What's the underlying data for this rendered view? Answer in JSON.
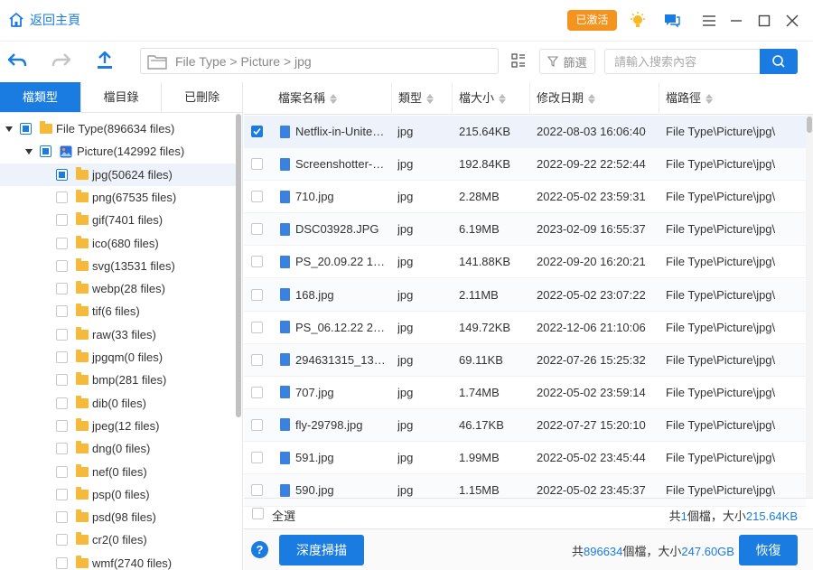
{
  "title_bar": {
    "home_label": "返回主頁",
    "activated_label": "已激活",
    "icons": [
      "home-icon",
      "lightbulb-icon",
      "feedback-icon",
      "menu-icon",
      "minimize-icon",
      "maximize-icon",
      "close-icon"
    ]
  },
  "toolbar": {
    "path": "File Type > Picture > jpg",
    "filter_label": "篩選",
    "search_placeholder": "請輸入搜索內容",
    "icons": [
      "back-icon",
      "forward-icon",
      "export-icon",
      "folder-icon",
      "view-toggle-icon",
      "filter-icon",
      "search-icon"
    ]
  },
  "left_panel": {
    "tabs": [
      "檔類型",
      "檔目錄",
      "已刪除"
    ],
    "active_tab": 0,
    "tree": [
      {
        "label": "File Type(896634 files)",
        "level": 0,
        "expanded": true,
        "check": "partial"
      },
      {
        "label": "Picture(142992 files)",
        "level": 1,
        "expanded": true,
        "check": "partial",
        "icon": "picture-icon"
      },
      {
        "label": "jpg(50624 files)",
        "level": 2,
        "check": "partial",
        "selected": true
      },
      {
        "label": "png(67535 files)",
        "level": 2,
        "check": "none"
      },
      {
        "label": "gif(7401 files)",
        "level": 2,
        "check": "none"
      },
      {
        "label": "ico(680 files)",
        "level": 2,
        "check": "none"
      },
      {
        "label": "svg(13531 files)",
        "level": 2,
        "check": "none"
      },
      {
        "label": "webp(28 files)",
        "level": 2,
        "check": "none"
      },
      {
        "label": "tif(6 files)",
        "level": 2,
        "check": "none"
      },
      {
        "label": "raw(33 files)",
        "level": 2,
        "check": "none"
      },
      {
        "label": "jpgqm(0 files)",
        "level": 2,
        "check": "none"
      },
      {
        "label": "bmp(281 files)",
        "level": 2,
        "check": "none"
      },
      {
        "label": "dib(0 files)",
        "level": 2,
        "check": "none"
      },
      {
        "label": "jpeg(12 files)",
        "level": 2,
        "check": "none"
      },
      {
        "label": "dng(0 files)",
        "level": 2,
        "check": "none"
      },
      {
        "label": "nef(0 files)",
        "level": 2,
        "check": "none"
      },
      {
        "label": "psp(0 files)",
        "level": 2,
        "check": "none"
      },
      {
        "label": "psd(98 files)",
        "level": 2,
        "check": "none"
      },
      {
        "label": "cr2(0 files)",
        "level": 2,
        "check": "none"
      },
      {
        "label": "wmf(2740 files)",
        "level": 2,
        "check": "none"
      }
    ]
  },
  "table": {
    "columns": [
      "檔案名稱",
      "類型",
      "檔大小",
      "修改日期",
      "檔路徑"
    ],
    "rows": [
      {
        "name": "Netflix-in-Unite…",
        "type": "jpg",
        "size": "215.64KB",
        "date": "2022-08-03 16:06:40",
        "path": "File Type\\Picture\\jpg\\",
        "checked": true
      },
      {
        "name": "Screenshotter-…",
        "type": "jpg",
        "size": "192.84KB",
        "date": "2022-09-22 22:52:44",
        "path": "File Type\\Picture\\jpg\\",
        "checked": false
      },
      {
        "name": "710.jpg",
        "type": "jpg",
        "size": "2.28MB",
        "date": "2022-05-02 23:59:31",
        "path": "File Type\\Picture\\jpg\\",
        "checked": false
      },
      {
        "name": "DSC03928.JPG",
        "type": "jpg",
        "size": "6.19MB",
        "date": "2023-02-09 16:55:37",
        "path": "File Type\\Picture\\jpg\\",
        "checked": false
      },
      {
        "name": "PS_20.09.22 1…",
        "type": "jpg",
        "size": "141.88KB",
        "date": "2022-09-20 16:20:21",
        "path": "File Type\\Picture\\jpg\\",
        "checked": false
      },
      {
        "name": "168.jpg",
        "type": "jpg",
        "size": "2.11MB",
        "date": "2022-05-02 23:07:22",
        "path": "File Type\\Picture\\jpg\\",
        "checked": false
      },
      {
        "name": "PS_06.12.22 2…",
        "type": "jpg",
        "size": "149.72KB",
        "date": "2022-12-06 21:10:06",
        "path": "File Type\\Picture\\jpg\\",
        "checked": false
      },
      {
        "name": "294631315_13…",
        "type": "jpg",
        "size": "69.11KB",
        "date": "2022-07-26 15:25:32",
        "path": "File Type\\Picture\\jpg\\",
        "checked": false
      },
      {
        "name": "707.jpg",
        "type": "jpg",
        "size": "1.74MB",
        "date": "2022-05-02 23:59:14",
        "path": "File Type\\Picture\\jpg\\",
        "checked": false
      },
      {
        "name": "fly-29798.jpg",
        "type": "jpg",
        "size": "46.17KB",
        "date": "2022-07-27 15:20:10",
        "path": "File Type\\Picture\\jpg\\",
        "checked": false
      },
      {
        "name": "591.jpg",
        "type": "jpg",
        "size": "1.99MB",
        "date": "2022-05-02 23:45:44",
        "path": "File Type\\Picture\\jpg\\",
        "checked": false
      },
      {
        "name": "590.jpg",
        "type": "jpg",
        "size": "1.15MB",
        "date": "2022-05-02 23:45:37",
        "path": "File Type\\Picture\\jpg\\",
        "checked": false
      }
    ]
  },
  "selection_bar": {
    "select_all_label": "全選",
    "prefix": "共",
    "count": "1",
    "mid": "個檔，大小",
    "size": "215.64KB"
  },
  "footer": {
    "help_label": "?",
    "deep_scan_label": "深度掃描",
    "prefix": "共",
    "total_count": "896634",
    "mid": "個檔，大小",
    "total_size": "247.60GB",
    "recover_label": "恢復"
  },
  "colors": {
    "accent": "#1a7be0",
    "activated_badge": "#f4931e",
    "folder": "#f5b93c"
  }
}
